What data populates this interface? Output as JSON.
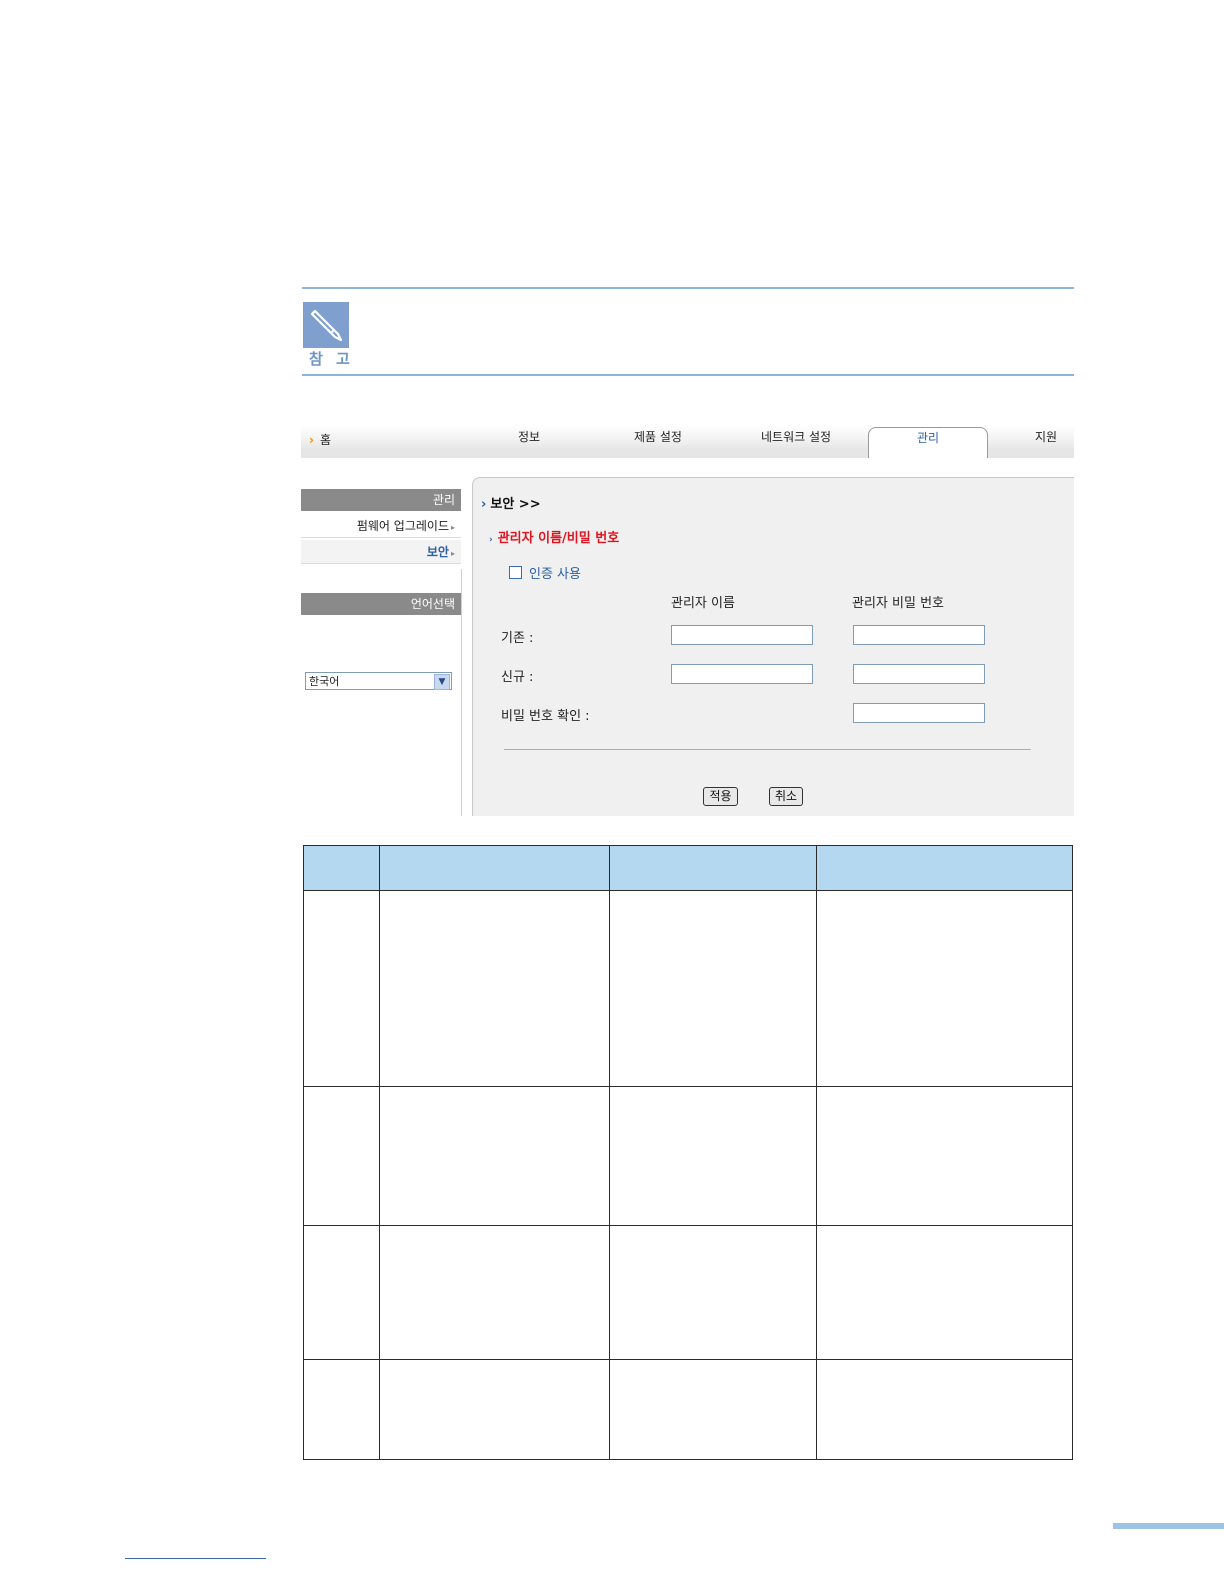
{
  "note": {
    "label": "참 고"
  },
  "web_ui": {
    "topnav": {
      "home": "홈",
      "tabs": [
        "정보",
        "제품 설정",
        "네트워크 설정",
        "관리",
        "지원"
      ],
      "active_tab": "관리"
    },
    "sidebar": {
      "section_header": "관리",
      "items": [
        {
          "label": "펌웨어 업그레이드",
          "selected": false
        },
        {
          "label": "보안",
          "selected": true
        }
      ],
      "language_header": "언어선택",
      "language_value": "한국어"
    },
    "content": {
      "title": "보안 >>",
      "subtitle": "관리자 이름/비밀 번호",
      "checkbox_label": "인증 사용",
      "checkbox_checked": false,
      "column_name": "관리자 이름",
      "column_password": "관리자 비밀 번호",
      "row_current": "기존 :",
      "row_new": "신규 :",
      "row_confirm": "비밀 번호 확인 :",
      "apply_button": "적용",
      "cancel_button": "취소"
    }
  },
  "colors": {
    "accent_blue": "#2a5ea6",
    "subtitle_red": "#e0141e",
    "table_header": "#b3d8ef",
    "note_line": "#8fb4da"
  }
}
